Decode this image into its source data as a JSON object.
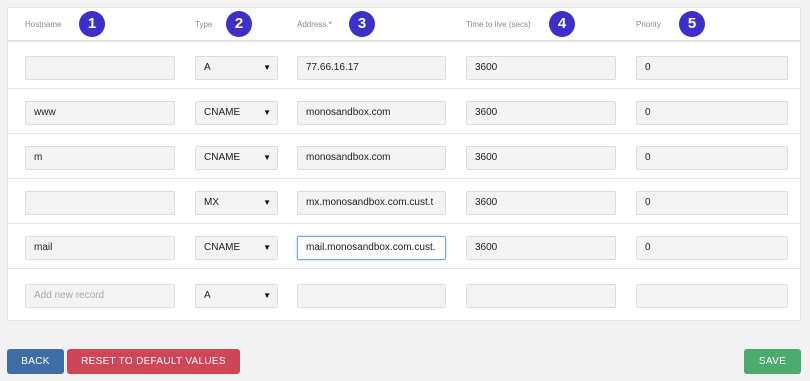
{
  "columns": [
    {
      "label": "Hostname",
      "badge": "1"
    },
    {
      "label": "Type",
      "badge": "2"
    },
    {
      "label": "Address *",
      "badge": "3"
    },
    {
      "label": "Time to live (secs)",
      "badge": "4"
    },
    {
      "label": "Priority",
      "badge": "5"
    }
  ],
  "records": [
    {
      "hostname": "",
      "type": "A",
      "address": "77.66.16.17",
      "ttl": "3600",
      "priority": "0"
    },
    {
      "hostname": "www",
      "type": "CNAME",
      "address": "monosandbox.com",
      "ttl": "3600",
      "priority": "0"
    },
    {
      "hostname": "m",
      "type": "CNAME",
      "address": "monosandbox.com",
      "ttl": "3600",
      "priority": "0"
    },
    {
      "hostname": "",
      "type": "MX",
      "address": "mx.monosandbox.com.cust.t",
      "ttl": "3600",
      "priority": "0"
    },
    {
      "hostname": "mail",
      "type": "CNAME",
      "address": "mail.monosandbox.com.cust.",
      "ttl": "3600",
      "priority": "0"
    }
  ],
  "new_record": {
    "hostname_placeholder": "Add new record",
    "type": "A",
    "address": "",
    "ttl": "",
    "priority": ""
  },
  "buttons": {
    "back": "BACK",
    "reset": "RESET TO DEFAULT VALUES",
    "save": "SAVE"
  },
  "caret_glyph": "▼",
  "colors": {
    "badge": "#3d2fc9",
    "back": "#3f6ea5",
    "reset": "#cf4757",
    "save": "#4bab6c"
  }
}
